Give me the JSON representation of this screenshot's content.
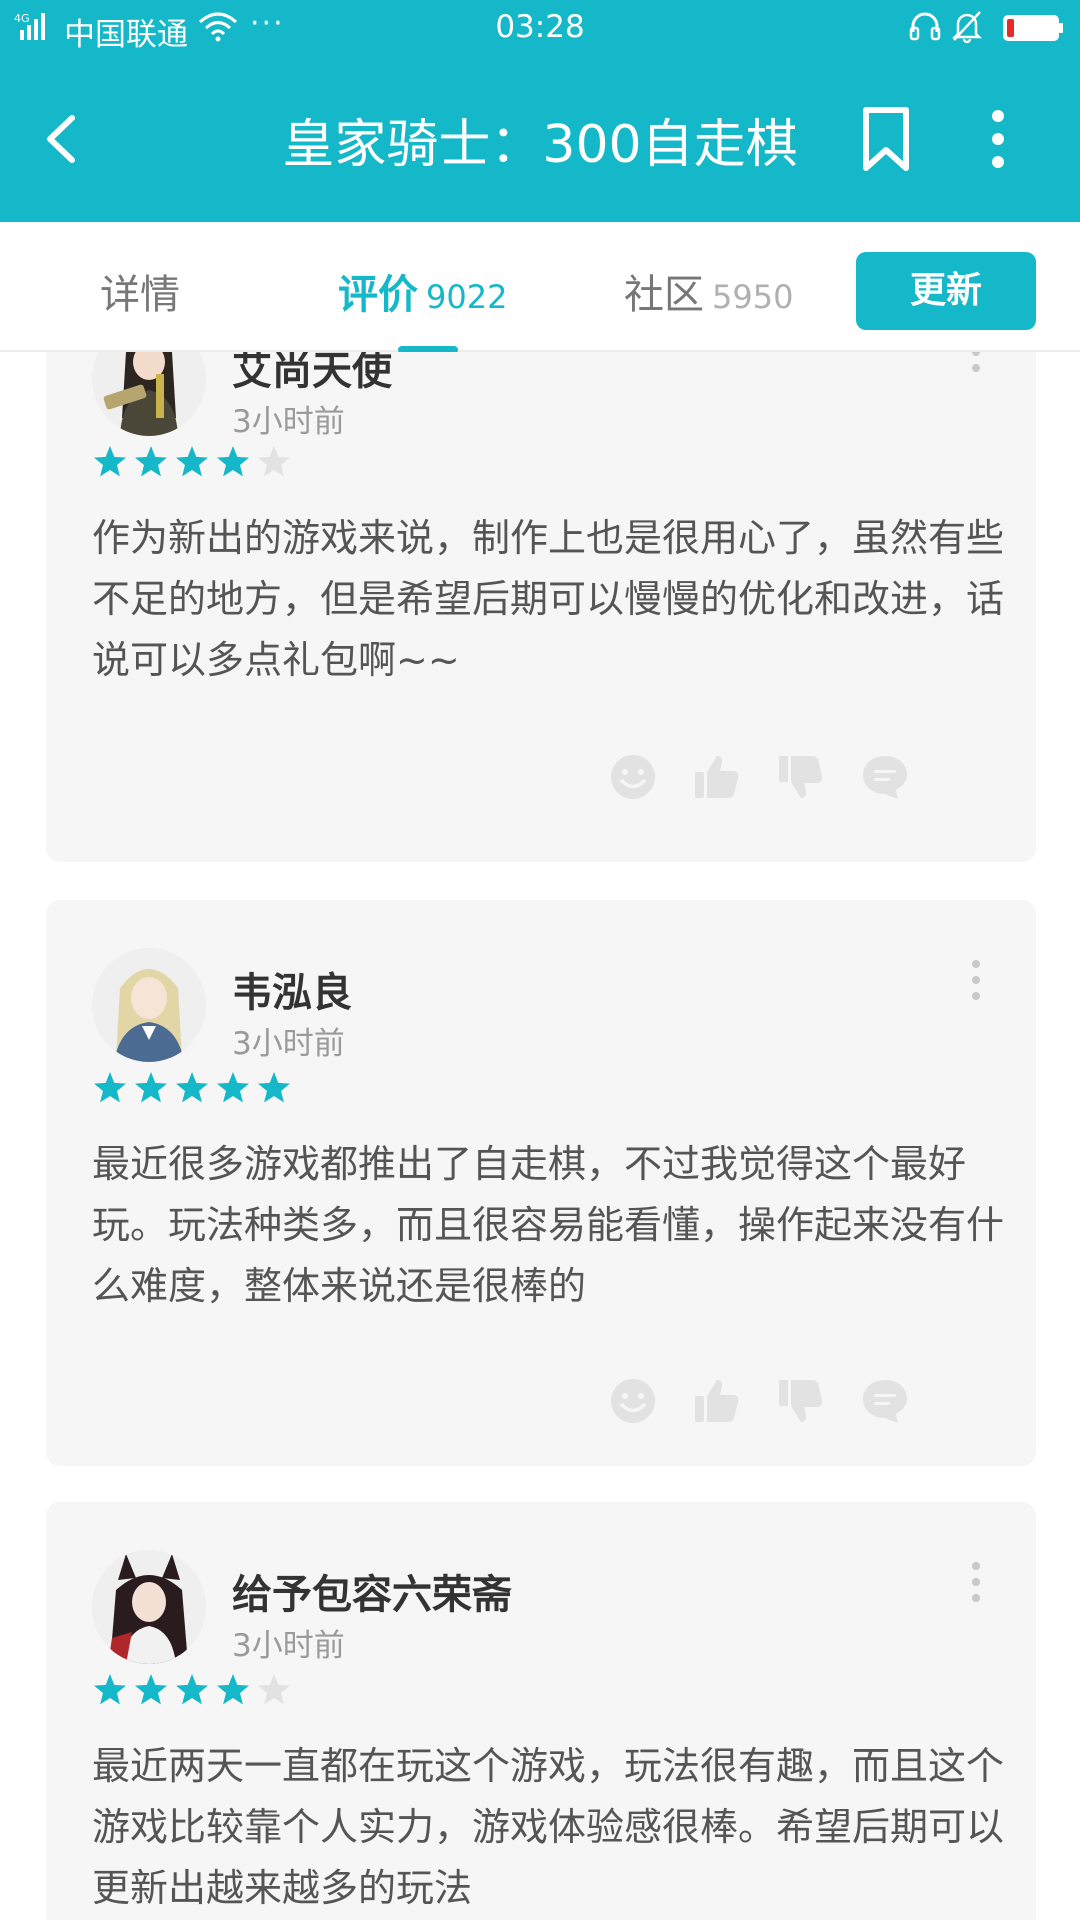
{
  "status_bar": {
    "network": "4G",
    "carrier": "中国联通",
    "more": "···",
    "time": "03:28",
    "icons": [
      "signal-icon",
      "wifi-icon",
      "headset-icon",
      "bell-muted-icon",
      "battery-low-icon"
    ],
    "battery_level": 0.15
  },
  "app_bar": {
    "title": "皇家骑士：300自走棋",
    "icons": [
      "back-arrow-icon",
      "bookmark-icon",
      "more-vertical-icon"
    ]
  },
  "tabs": [
    {
      "label": "详情",
      "count": ""
    },
    {
      "label": "评价",
      "count": "9022",
      "active": true
    },
    {
      "label": "社区",
      "count": "5950"
    }
  ],
  "update_button": "更新",
  "colors": {
    "accent": "#14b8c8",
    "star_empty": "#e2e2e2",
    "card_bg": "#f6f6f6"
  },
  "reviews": [
    {
      "user": "艾尚天使",
      "time": "3小时前",
      "rating": 4,
      "text": "作为新出的游戏来说，制作上也是很用心了，虽然有些不足的地方，但是希望后期可以慢慢的优化和改进，话说可以多点礼包啊~~"
    },
    {
      "user": "韦泓良",
      "time": "3小时前",
      "rating": 5,
      "text": "最近很多游戏都推出了自走棋，不过我觉得这个最好玩。玩法种类多，而且很容易能看懂，操作起来没有什么难度，整体来说还是很棒的"
    },
    {
      "user": "给予包容六荣斋",
      "time": "3小时前",
      "rating": 4,
      "text": "最近两天一直都在玩这个游戏，玩法很有趣，而且这个游戏比较靠个人实力，游戏体验感很棒。希望后期可以更新出越来越多的玩法"
    }
  ],
  "review_action_icons": [
    "emoji-icon",
    "thumbs-up-icon",
    "thumbs-down-icon",
    "comment-icon"
  ]
}
